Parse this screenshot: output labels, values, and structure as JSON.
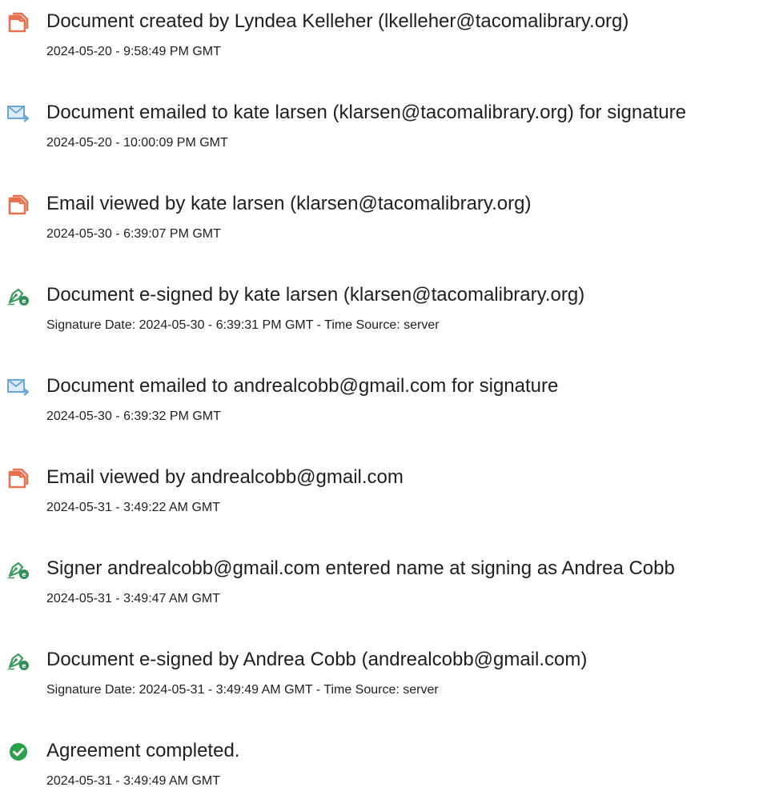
{
  "events": [
    {
      "icon": "document-created-icon",
      "title": "Document created by Lyndea Kelleher (lkelleher@tacomalibrary.org)",
      "meta": "2024-05-20 - 9:58:49 PM GMT"
    },
    {
      "icon": "email-sent-icon",
      "title": "Document emailed to kate larsen (klarsen@tacomalibrary.org) for signature",
      "meta": "2024-05-20 - 10:00:09 PM GMT"
    },
    {
      "icon": "document-viewed-icon",
      "title": "Email viewed by kate larsen (klarsen@tacomalibrary.org)",
      "meta": "2024-05-30 - 6:39:07 PM GMT"
    },
    {
      "icon": "esign-pen-icon",
      "title": "Document e-signed by kate larsen (klarsen@tacomalibrary.org)",
      "meta": "Signature Date: 2024-05-30 - 6:39:31 PM GMT - Time Source: server"
    },
    {
      "icon": "email-sent-icon",
      "title": "Document emailed to andrealcobb@gmail.com for signature",
      "meta": "2024-05-30 - 6:39:32 PM GMT"
    },
    {
      "icon": "document-viewed-icon",
      "title": "Email viewed by andrealcobb@gmail.com",
      "meta": "2024-05-31 - 3:49:22 AM GMT"
    },
    {
      "icon": "esign-pen-icon",
      "title": "Signer andrealcobb@gmail.com entered name at signing as Andrea Cobb",
      "meta": "2024-05-31 - 3:49:47 AM GMT"
    },
    {
      "icon": "esign-pen-icon",
      "title": "Document e-signed by Andrea Cobb (andrealcobb@gmail.com)",
      "meta": "Signature Date: 2024-05-31 - 3:49:49 AM GMT - Time Source: server"
    },
    {
      "icon": "check-circle-icon",
      "title": "Agreement completed.",
      "meta": "2024-05-31 - 3:49:49 AM GMT"
    }
  ],
  "colors": {
    "document_icon": "#e8704f",
    "email_icon": "#6ba6d8",
    "pen_icon": "#3a9a5c",
    "check_icon": "#2ba04a",
    "text": "#1f1f1f"
  }
}
